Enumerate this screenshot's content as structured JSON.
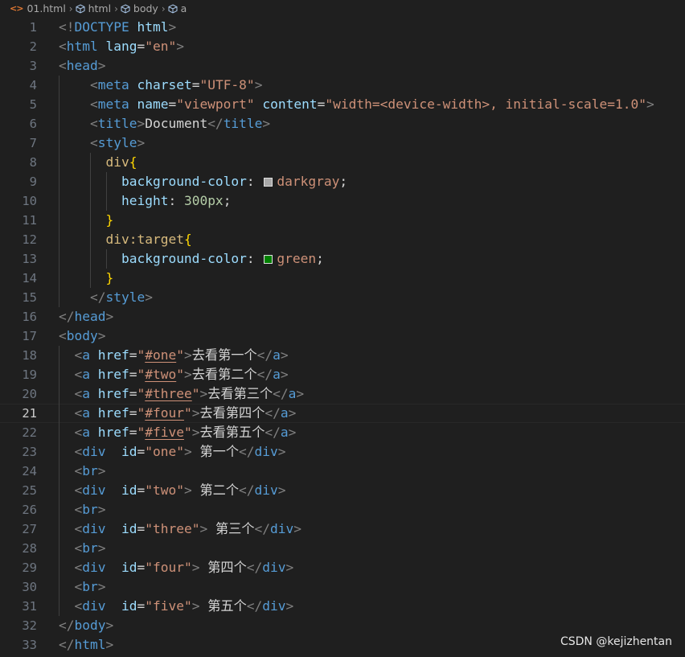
{
  "breadcrumb": {
    "file": "01.html",
    "items": [
      "html",
      "body",
      "a"
    ]
  },
  "colors": {
    "background": "#1f1f1f",
    "tag": "#569cd6",
    "attribute": "#9cdcfe",
    "string": "#ce9178",
    "selector": "#d7ba7d",
    "brace": "#ffd700",
    "number": "#b5cea8",
    "darkgray_swatch": "#a9a9a9",
    "green_swatch": "#008000"
  },
  "editor": {
    "current_line": 21,
    "lines": [
      {
        "n": "1",
        "text": "<!DOCTYPE html>"
      },
      {
        "n": "2",
        "text": "<html lang=\"en\">"
      },
      {
        "n": "3",
        "text": "<head>"
      },
      {
        "n": "4",
        "text": "    <meta charset=\"UTF-8\">"
      },
      {
        "n": "5",
        "text": "    <meta name=\"viewport\" content=\"width=<device-width>, initial-scale=1.0\">"
      },
      {
        "n": "6",
        "text": "    <title>Document</title>"
      },
      {
        "n": "7",
        "text": "    <style>"
      },
      {
        "n": "8",
        "text": "      div{"
      },
      {
        "n": "9",
        "text": "        background-color: darkgray;"
      },
      {
        "n": "10",
        "text": "        height: 300px;"
      },
      {
        "n": "11",
        "text": "      }"
      },
      {
        "n": "12",
        "text": "      div:target{"
      },
      {
        "n": "13",
        "text": "        background-color: green;"
      },
      {
        "n": "14",
        "text": "      }"
      },
      {
        "n": "15",
        "text": "    </style>"
      },
      {
        "n": "16",
        "text": "</head>"
      },
      {
        "n": "17",
        "text": "<body>"
      },
      {
        "n": "18",
        "text": "  <a href=\"#one\">去看第一个</a>"
      },
      {
        "n": "19",
        "text": "  <a href=\"#two\">去看第二个</a>"
      },
      {
        "n": "20",
        "text": "  <a href=\"#three\">去看第三个</a>"
      },
      {
        "n": "21",
        "text": "  <a href=\"#four\">去看第四个</a>"
      },
      {
        "n": "22",
        "text": "  <a href=\"#five\">去看第五个</a>"
      },
      {
        "n": "23",
        "text": "  <div  id=\"one\"> 第一个</div>"
      },
      {
        "n": "24",
        "text": "  <br>"
      },
      {
        "n": "25",
        "text": "  <div  id=\"two\"> 第二个</div>"
      },
      {
        "n": "26",
        "text": "  <br>"
      },
      {
        "n": "27",
        "text": "  <div  id=\"three\"> 第三个</div>"
      },
      {
        "n": "28",
        "text": "  <br>"
      },
      {
        "n": "29",
        "text": "  <div  id=\"four\"> 第四个</div>"
      },
      {
        "n": "30",
        "text": "  <br>"
      },
      {
        "n": "31",
        "text": "  <div  id=\"five\"> 第五个</div>"
      },
      {
        "n": "32",
        "text": "</body>"
      },
      {
        "n": "33",
        "text": "</html>"
      }
    ]
  },
  "watermark": "CSDN @kejizhentan"
}
